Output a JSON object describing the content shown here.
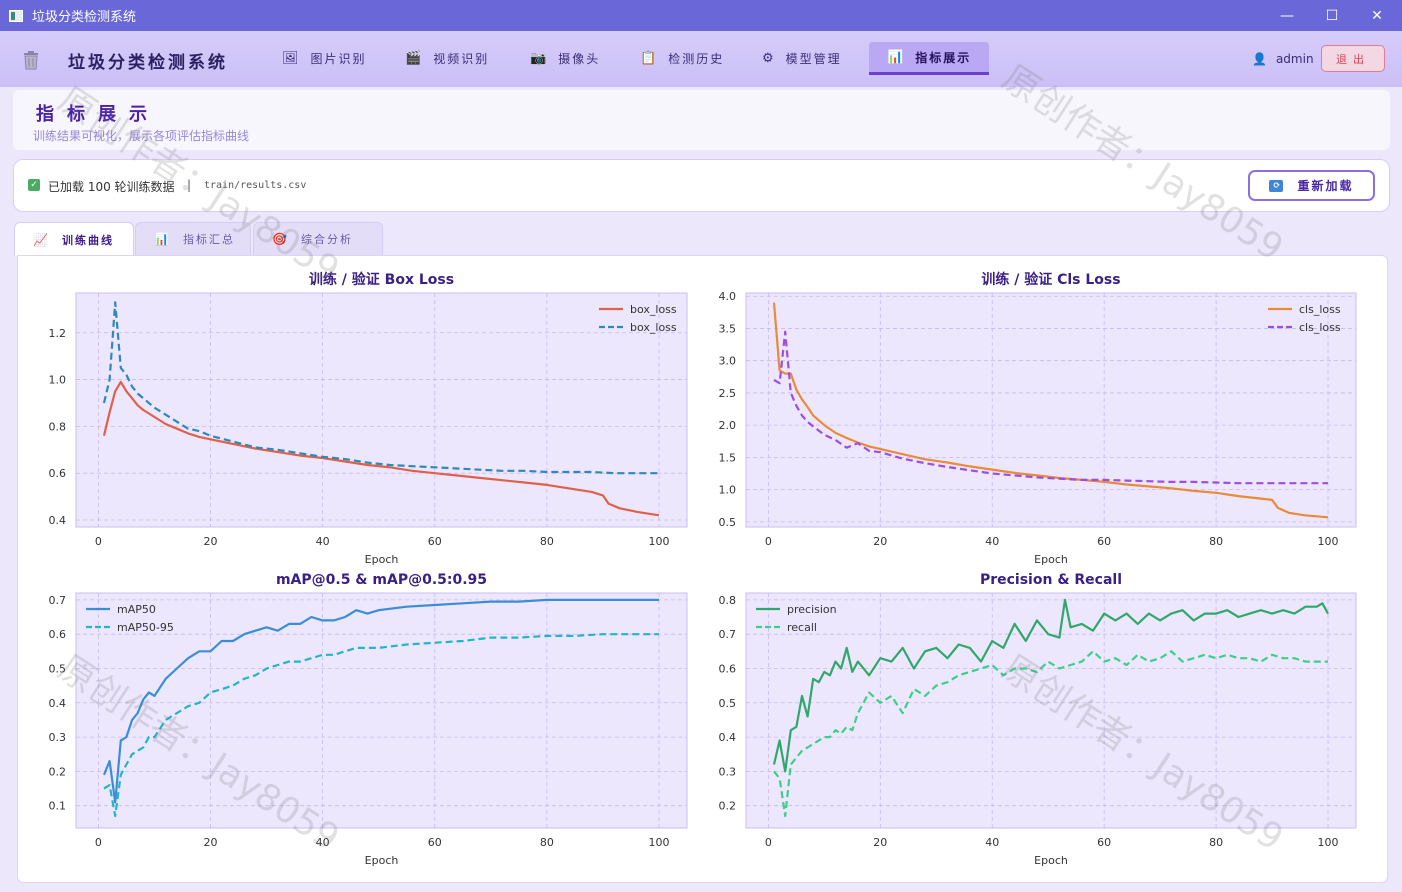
{
  "window": {
    "title": "垃圾分类检测系统",
    "controls": [
      "—",
      "☐",
      "✕"
    ]
  },
  "nav": {
    "app_name": "垃圾分类检测系统",
    "items": [
      {
        "label": "图片识别",
        "icon": "🖼"
      },
      {
        "label": "视频识别",
        "icon": "🎬"
      },
      {
        "label": "摄像头",
        "icon": "📷"
      },
      {
        "label": "检测历史",
        "icon": "📋"
      },
      {
        "label": "模型管理",
        "icon": "⚙"
      },
      {
        "label": "指标展示",
        "icon": "📊",
        "active": true
      }
    ],
    "user": "admin",
    "logout": "退出"
  },
  "header": {
    "title": "指标展示",
    "subtitle": "训练结果可视化，展示各项评估指标曲线"
  },
  "info": {
    "status": "已加载 100 轮训练数据",
    "separator": "|",
    "path": "train/results.csv",
    "reload": "重新加载"
  },
  "tabs": [
    {
      "label": "训练曲线",
      "icon": "📈",
      "active": true
    },
    {
      "label": "指标汇总",
      "icon": "📊"
    },
    {
      "label": "综合分析",
      "icon": "🎯"
    }
  ],
  "watermarks": [
    "原创作者：Jay8059",
    "原创作者：Jay8059",
    "原创作者：Jay8059",
    "原创作者：Jay8059"
  ],
  "chart_data": [
    {
      "type": "line",
      "title": "训练 / 验证  Box Loss",
      "xlabel": "Epoch",
      "xlim": [
        -4,
        105
      ],
      "ylim": [
        0.37,
        1.37
      ],
      "xticks": [
        0,
        20,
        40,
        60,
        80,
        100
      ],
      "yticks": [
        0.4,
        0.6,
        0.8,
        1.0,
        1.2
      ],
      "legend": "top-right",
      "series": [
        {
          "name": "box_loss",
          "color": "#e0604a",
          "dash": false,
          "x": [
            1,
            2,
            3,
            4,
            5,
            6,
            7,
            8,
            10,
            12,
            14,
            16,
            18,
            20,
            24,
            28,
            32,
            36,
            40,
            44,
            48,
            52,
            56,
            60,
            64,
            68,
            72,
            76,
            80,
            84,
            88,
            90,
            91,
            93,
            96,
            100
          ],
          "y": [
            0.76,
            0.86,
            0.95,
            0.99,
            0.95,
            0.92,
            0.89,
            0.87,
            0.84,
            0.81,
            0.79,
            0.77,
            0.755,
            0.745,
            0.725,
            0.705,
            0.69,
            0.675,
            0.665,
            0.65,
            0.635,
            0.625,
            0.61,
            0.6,
            0.59,
            0.58,
            0.57,
            0.56,
            0.55,
            0.535,
            0.52,
            0.505,
            0.47,
            0.45,
            0.435,
            0.42
          ]
        },
        {
          "name": "box_loss",
          "color": "#2e88b8",
          "dash": true,
          "x": [
            1,
            2,
            3,
            4,
            5,
            6,
            7,
            8,
            10,
            12,
            14,
            16,
            18,
            20,
            24,
            28,
            32,
            36,
            40,
            44,
            48,
            52,
            56,
            60,
            64,
            68,
            72,
            76,
            80,
            84,
            88,
            92,
            96,
            100
          ],
          "y": [
            0.9,
            1.0,
            1.33,
            1.05,
            1.02,
            0.97,
            0.94,
            0.92,
            0.88,
            0.85,
            0.82,
            0.79,
            0.78,
            0.76,
            0.735,
            0.71,
            0.7,
            0.685,
            0.67,
            0.66,
            0.645,
            0.635,
            0.63,
            0.625,
            0.62,
            0.615,
            0.61,
            0.61,
            0.605,
            0.605,
            0.605,
            0.6,
            0.6,
            0.6
          ]
        }
      ]
    },
    {
      "type": "line",
      "title": "训练 / 验证  Cls Loss",
      "xlabel": "Epoch",
      "xlim": [
        -4,
        105
      ],
      "ylim": [
        0.42,
        4.05
      ],
      "xticks": [
        0,
        20,
        40,
        60,
        80,
        100
      ],
      "yticks": [
        0.5,
        1.0,
        1.5,
        2.0,
        2.5,
        3.0,
        3.5,
        4.0
      ],
      "legend": "top-right",
      "series": [
        {
          "name": "cls_loss",
          "color": "#ea8a3a",
          "dash": false,
          "x": [
            1,
            2,
            3,
            4,
            5,
            6,
            7,
            8,
            10,
            12,
            14,
            16,
            18,
            20,
            24,
            28,
            32,
            36,
            40,
            44,
            48,
            52,
            56,
            60,
            64,
            68,
            72,
            76,
            80,
            84,
            88,
            90,
            91,
            93,
            96,
            100
          ],
          "y": [
            3.9,
            2.85,
            2.8,
            2.8,
            2.55,
            2.4,
            2.28,
            2.15,
            2.0,
            1.88,
            1.8,
            1.73,
            1.67,
            1.63,
            1.55,
            1.47,
            1.42,
            1.36,
            1.31,
            1.26,
            1.22,
            1.18,
            1.15,
            1.12,
            1.08,
            1.05,
            1.02,
            0.98,
            0.95,
            0.9,
            0.86,
            0.84,
            0.72,
            0.64,
            0.6,
            0.57
          ]
        },
        {
          "name": "cls_loss",
          "color": "#9b4fe0",
          "dash": true,
          "x": [
            1,
            2,
            3,
            4,
            5,
            6,
            7,
            8,
            10,
            12,
            14,
            16,
            18,
            20,
            24,
            28,
            32,
            36,
            40,
            44,
            48,
            52,
            56,
            60,
            64,
            68,
            72,
            76,
            80,
            84,
            88,
            92,
            96,
            100
          ],
          "y": [
            2.7,
            2.65,
            3.45,
            2.5,
            2.3,
            2.15,
            2.05,
            1.98,
            1.85,
            1.77,
            1.65,
            1.72,
            1.6,
            1.58,
            1.48,
            1.41,
            1.35,
            1.3,
            1.25,
            1.22,
            1.19,
            1.17,
            1.15,
            1.15,
            1.14,
            1.13,
            1.12,
            1.12,
            1.11,
            1.1,
            1.1,
            1.1,
            1.1,
            1.1
          ]
        }
      ]
    },
    {
      "type": "line",
      "title": "mAP@0.5  &  mAP@0.5:0.95",
      "xlabel": "Epoch",
      "xlim": [
        -4,
        105
      ],
      "ylim": [
        0.035,
        0.72
      ],
      "xticks": [
        0,
        20,
        40,
        60,
        80,
        100
      ],
      "yticks": [
        0.1,
        0.2,
        0.3,
        0.4,
        0.5,
        0.6,
        0.7
      ],
      "legend": "top-left",
      "series": [
        {
          "name": "mAP50",
          "color": "#3a8ed6",
          "dash": false,
          "x": [
            1,
            2,
            3,
            4,
            5,
            6,
            7,
            8,
            9,
            10,
            12,
            14,
            16,
            18,
            20,
            22,
            24,
            26,
            28,
            30,
            32,
            34,
            36,
            38,
            40,
            42,
            44,
            46,
            48,
            50,
            55,
            60,
            65,
            70,
            75,
            80,
            85,
            90,
            95,
            100
          ],
          "y": [
            0.19,
            0.23,
            0.11,
            0.29,
            0.3,
            0.35,
            0.37,
            0.41,
            0.43,
            0.42,
            0.47,
            0.5,
            0.53,
            0.55,
            0.55,
            0.58,
            0.58,
            0.6,
            0.61,
            0.62,
            0.61,
            0.63,
            0.63,
            0.65,
            0.64,
            0.64,
            0.65,
            0.67,
            0.66,
            0.67,
            0.68,
            0.685,
            0.69,
            0.695,
            0.695,
            0.7,
            0.7,
            0.7,
            0.7,
            0.7
          ]
        },
        {
          "name": "mAP50-95",
          "color": "#22b5c8",
          "dash": true,
          "x": [
            1,
            2,
            3,
            4,
            5,
            6,
            7,
            8,
            9,
            10,
            12,
            14,
            16,
            18,
            20,
            22,
            24,
            26,
            28,
            30,
            32,
            34,
            36,
            38,
            40,
            42,
            44,
            46,
            48,
            50,
            55,
            60,
            65,
            70,
            75,
            80,
            85,
            90,
            95,
            100
          ],
          "y": [
            0.15,
            0.16,
            0.07,
            0.19,
            0.22,
            0.25,
            0.26,
            0.27,
            0.3,
            0.3,
            0.35,
            0.37,
            0.39,
            0.4,
            0.43,
            0.44,
            0.45,
            0.47,
            0.48,
            0.5,
            0.51,
            0.52,
            0.52,
            0.53,
            0.54,
            0.54,
            0.55,
            0.56,
            0.56,
            0.56,
            0.57,
            0.575,
            0.58,
            0.59,
            0.59,
            0.595,
            0.595,
            0.6,
            0.6,
            0.6
          ]
        }
      ]
    },
    {
      "type": "line",
      "title": "Precision  &  Recall",
      "xlabel": "Epoch",
      "xlim": [
        -4,
        105
      ],
      "ylim": [
        0.135,
        0.82
      ],
      "xticks": [
        0,
        20,
        40,
        60,
        80,
        100
      ],
      "yticks": [
        0.2,
        0.3,
        0.4,
        0.5,
        0.6,
        0.7,
        0.8
      ],
      "legend": "top-left",
      "series": [
        {
          "name": "precision",
          "color": "#2fa86a",
          "dash": false,
          "x": [
            1,
            2,
            3,
            4,
            5,
            6,
            7,
            8,
            9,
            10,
            11,
            12,
            13,
            14,
            15,
            16,
            18,
            20,
            22,
            24,
            26,
            28,
            30,
            32,
            34,
            36,
            38,
            40,
            42,
            44,
            46,
            48,
            50,
            52,
            53,
            54,
            56,
            58,
            60,
            62,
            64,
            66,
            68,
            70,
            72,
            74,
            76,
            78,
            80,
            82,
            84,
            86,
            88,
            90,
            92,
            94,
            96,
            98,
            99,
            100
          ],
          "y": [
            0.32,
            0.39,
            0.3,
            0.42,
            0.43,
            0.52,
            0.46,
            0.57,
            0.56,
            0.59,
            0.58,
            0.62,
            0.6,
            0.66,
            0.59,
            0.62,
            0.58,
            0.63,
            0.62,
            0.66,
            0.6,
            0.65,
            0.66,
            0.63,
            0.67,
            0.66,
            0.62,
            0.68,
            0.66,
            0.73,
            0.68,
            0.74,
            0.7,
            0.69,
            0.8,
            0.72,
            0.73,
            0.71,
            0.76,
            0.74,
            0.76,
            0.73,
            0.76,
            0.74,
            0.76,
            0.77,
            0.74,
            0.76,
            0.76,
            0.77,
            0.75,
            0.76,
            0.77,
            0.76,
            0.77,
            0.76,
            0.78,
            0.78,
            0.79,
            0.76
          ]
        },
        {
          "name": "recall",
          "color": "#3ccf88",
          "dash": true,
          "x": [
            1,
            2,
            3,
            4,
            5,
            6,
            7,
            8,
            9,
            10,
            11,
            12,
            13,
            14,
            15,
            16,
            18,
            20,
            22,
            24,
            26,
            28,
            30,
            32,
            34,
            36,
            38,
            40,
            42,
            44,
            46,
            48,
            50,
            52,
            54,
            56,
            58,
            60,
            62,
            64,
            66,
            68,
            70,
            72,
            74,
            76,
            78,
            80,
            82,
            84,
            86,
            88,
            90,
            92,
            94,
            96,
            98,
            100
          ],
          "y": [
            0.3,
            0.28,
            0.17,
            0.32,
            0.34,
            0.36,
            0.37,
            0.38,
            0.39,
            0.4,
            0.4,
            0.42,
            0.41,
            0.43,
            0.42,
            0.47,
            0.53,
            0.5,
            0.52,
            0.47,
            0.54,
            0.52,
            0.55,
            0.56,
            0.58,
            0.59,
            0.6,
            0.61,
            0.58,
            0.6,
            0.6,
            0.59,
            0.62,
            0.6,
            0.61,
            0.62,
            0.65,
            0.62,
            0.63,
            0.61,
            0.64,
            0.62,
            0.63,
            0.65,
            0.62,
            0.63,
            0.64,
            0.63,
            0.64,
            0.63,
            0.63,
            0.62,
            0.64,
            0.63,
            0.63,
            0.62,
            0.62,
            0.62
          ]
        }
      ]
    }
  ]
}
